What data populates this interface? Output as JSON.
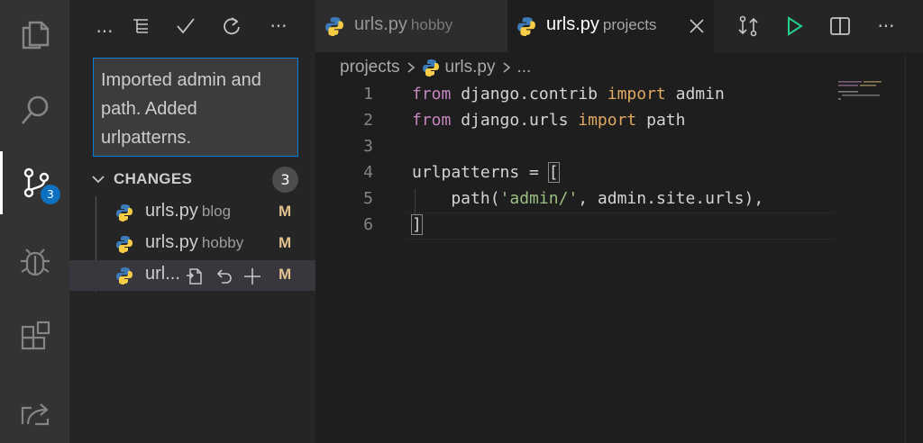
{
  "activity_bar": {
    "items": [
      "explorer-icon",
      "search-icon",
      "source-control-icon",
      "debug-icon",
      "extensions-icon",
      "remote-icon"
    ],
    "source_control_badge": "3"
  },
  "sidebar": {
    "toolbar": {
      "more_left": "...",
      "view_as_tree": "tree-icon",
      "commit": "check-icon",
      "refresh": "refresh-icon",
      "more": "···"
    },
    "commit_message": "Imported admin and path. Added urlpatterns.",
    "changes_label": "CHANGES",
    "changes_count": "3",
    "files": [
      {
        "name": "urls.py",
        "dir": "blog",
        "status": "M"
      },
      {
        "name": "urls.py",
        "dir": "hobby",
        "status": "M"
      },
      {
        "name": "url...",
        "dir": "",
        "status": "M"
      }
    ]
  },
  "tabs": [
    {
      "name": "urls.py",
      "dir": "hobby",
      "active": false
    },
    {
      "name": "urls.py",
      "dir": "projects",
      "active": true
    }
  ],
  "breadcrumb": {
    "folder": "projects",
    "file": "urls.py",
    "tail": "..."
  },
  "editor": {
    "line_numbers": [
      "1",
      "2",
      "3",
      "4",
      "5",
      "6"
    ],
    "colors": {
      "keyword": "#c586c0",
      "import_keyword": "#e0a861",
      "string": "#9bbf84",
      "text": "#d4d4d4"
    }
  }
}
